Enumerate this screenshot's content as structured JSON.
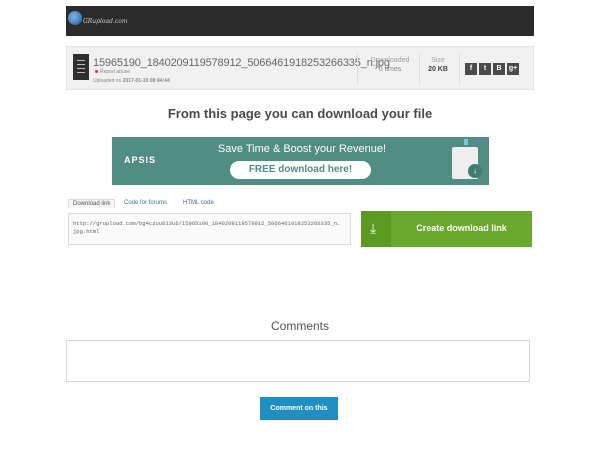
{
  "site": {
    "logo_text": "GRupload.com",
    "logo_icon": "globe-icon"
  },
  "file": {
    "name": "15965190_1840209119578912_5066461918253266335_n.jpg",
    "report_abuse": "Report abuse",
    "uploaded_label": "Uploaded on",
    "uploaded_date": "2017-01-19 08:44:44",
    "downloaded_label": "Downloaded",
    "downloaded_value": "0 times",
    "size_label": "Size",
    "size_value": "20 KB",
    "file_icon": "document-icon"
  },
  "share": {
    "buttons": [
      "f",
      "t",
      "B",
      "g+"
    ]
  },
  "headline": "From this page you can download your file",
  "ad": {
    "brand": "APSIS",
    "headline": "Save Time & Boost your Revenue!",
    "cta": "FREE download here!",
    "adchoices_icon": "adchoices-icon",
    "close_label": "✕",
    "accent_color": "#518d83"
  },
  "link_tabs": {
    "tabs": [
      "Download link",
      "Code for forums",
      "HTML code"
    ]
  },
  "download_link": "http://grupload.com/bg4czuu613u6/15965190_1840209119578912_5066461918253266335_n.jpg.html",
  "create_button": {
    "label": "Create download link",
    "icon": "download-arrow-icon",
    "color": "#6aa92d"
  },
  "comments": {
    "title": "Comments",
    "button": "Comment on this",
    "value": ""
  }
}
